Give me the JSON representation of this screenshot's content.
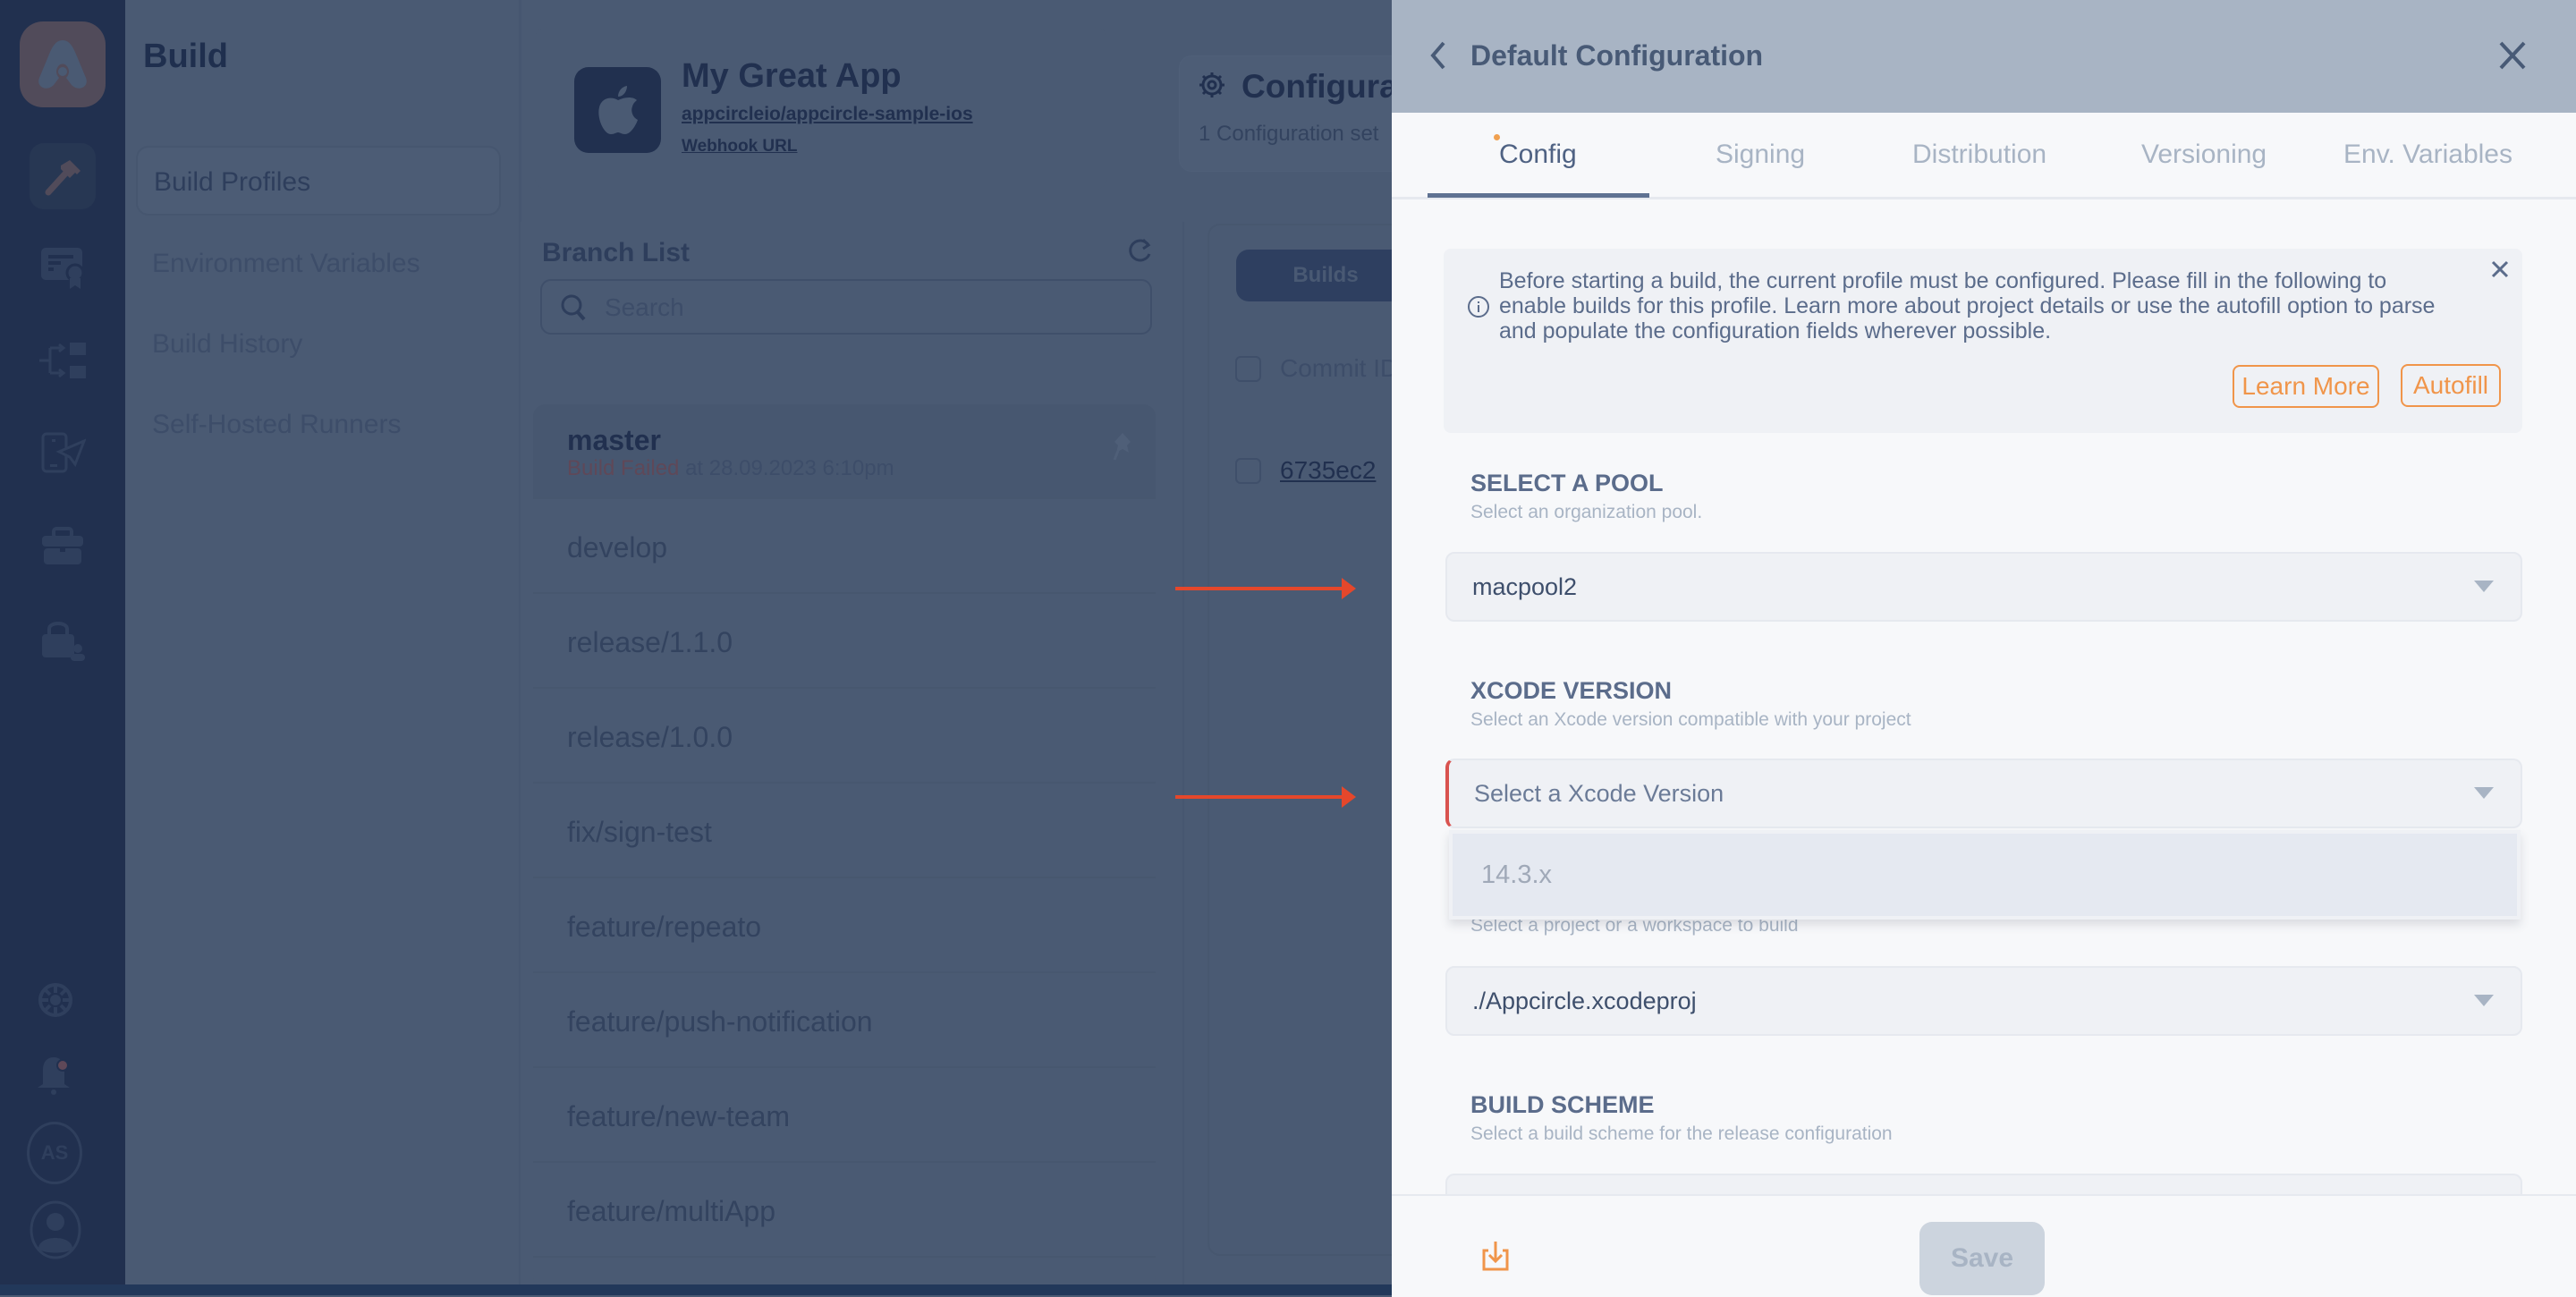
{
  "rail": {
    "items": [
      {
        "icon": "hammer-icon",
        "label": "Build",
        "active": true
      },
      {
        "icon": "certificate-icon",
        "label": "Signing Identities"
      },
      {
        "icon": "distribution-icon",
        "label": "Testing Distribution"
      },
      {
        "icon": "publish-icon",
        "label": "Publish"
      },
      {
        "icon": "briefcase-icon",
        "label": "Enterprise Store"
      },
      {
        "icon": "lock-user-icon",
        "label": "Account"
      }
    ],
    "bottom": {
      "settings_icon": "settings-icon",
      "notifications_icon": "bell-icon",
      "org_initials": "AS",
      "profile_icon": "user-icon"
    }
  },
  "sidebar": {
    "title": "Build",
    "items": [
      {
        "label": "Build Profiles",
        "active": true
      },
      {
        "label": "Environment Variables"
      },
      {
        "label": "Build History"
      },
      {
        "label": "Self-Hosted Runners"
      }
    ]
  },
  "app": {
    "name": "My Great App",
    "repo": "appcircleio/appcircle-sample-ios",
    "webhook": "Webhook URL",
    "config_title": "Configura",
    "config_sub": "1 Configuration set"
  },
  "branches": {
    "title": "Branch List",
    "search_placeholder": "Search",
    "items": [
      {
        "name": "master",
        "status": "Build Failed",
        "time": " at 28.09.2023 6:10pm"
      },
      {
        "name": "develop"
      },
      {
        "name": "release/1.1.0"
      },
      {
        "name": "release/1.0.0"
      },
      {
        "name": "fix/sign-test"
      },
      {
        "name": "feature/repeato"
      },
      {
        "name": "feature/push-notification"
      },
      {
        "name": "feature/new-team"
      },
      {
        "name": "feature/multiApp"
      }
    ]
  },
  "builds": {
    "tab_label": "Builds",
    "column_header": "Commit ID",
    "rows": [
      {
        "commit": "6735ec2"
      }
    ]
  },
  "drawer": {
    "title": "Default Configuration",
    "tabs": [
      {
        "label": "Config",
        "active": true,
        "indicator": true
      },
      {
        "label": "Signing"
      },
      {
        "label": "Distribution"
      },
      {
        "label": "Versioning"
      },
      {
        "label": "Env. Variables"
      }
    ],
    "info": {
      "text": "Before starting a build, the current profile must be configured. Please fill in the following to enable builds for this profile. Learn more about project details or use the autofill option to parse and populate the configuration fields wherever possible.",
      "learn_more": "Learn More",
      "autofill": "Autofill"
    },
    "sections": {
      "pool": {
        "title": "SELECT A POOL",
        "subtitle": "Select an organization pool.",
        "value": "macpool2"
      },
      "xcode": {
        "title": "XCODE VERSION",
        "subtitle": "Select an Xcode version compatible with your project",
        "placeholder": "Select a Xcode Version",
        "options": [
          "14.3.x"
        ]
      },
      "project": {
        "subtitle": "Select a project or a workspace to build",
        "value": "./Appcircle.xcodeproj"
      },
      "scheme": {
        "title": "BUILD SCHEME",
        "subtitle": "Select a build scheme for the release configuration"
      }
    },
    "footer": {
      "save_label": "Save",
      "download_icon": "download-icon"
    }
  },
  "colors": {
    "accent_orange": "#f0954a",
    "error_red": "#d9534f",
    "annotation_arrow": "#e5472b",
    "rail_bg": "#21304f"
  }
}
